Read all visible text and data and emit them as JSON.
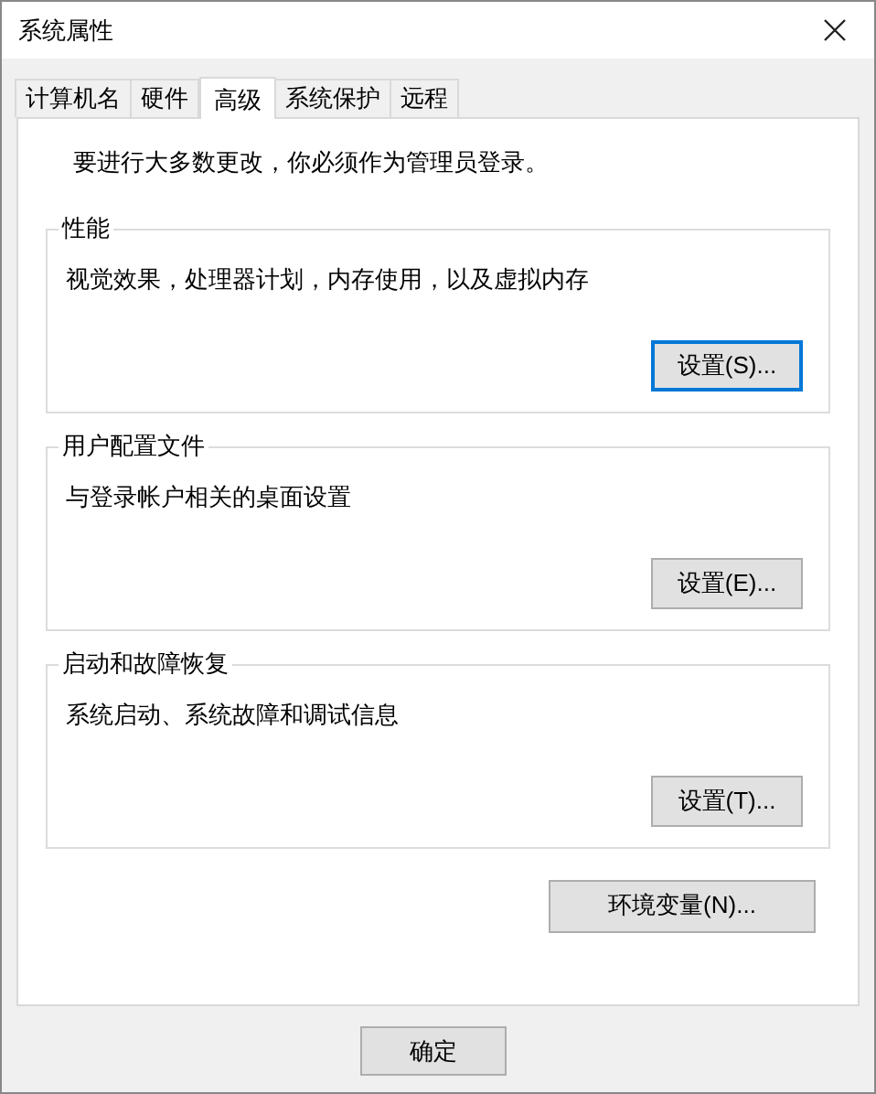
{
  "window": {
    "title": "系统属性"
  },
  "tabs": [
    {
      "label": "计算机名",
      "selected": false
    },
    {
      "label": "硬件",
      "selected": false
    },
    {
      "label": "高级",
      "selected": true
    },
    {
      "label": "系统保护",
      "selected": false
    },
    {
      "label": "远程",
      "selected": false
    }
  ],
  "notice": "要进行大多数更改，你必须作为管理员登录。",
  "groups": [
    {
      "title": "性能",
      "description": "视觉效果，处理器计划，内存使用，以及虚拟内存",
      "button": {
        "label": "设置(S)...",
        "default": true
      }
    },
    {
      "title": "用户配置文件",
      "description": "与登录帐户相关的桌面设置",
      "button": {
        "label": "设置(E)...",
        "default": false
      }
    },
    {
      "title": "启动和故障恢复",
      "description": "系统启动、系统故障和调试信息",
      "button": {
        "label": "设置(T)...",
        "default": false
      }
    }
  ],
  "env_button": "环境变量(N)...",
  "footer_buttons": [
    "确定"
  ]
}
